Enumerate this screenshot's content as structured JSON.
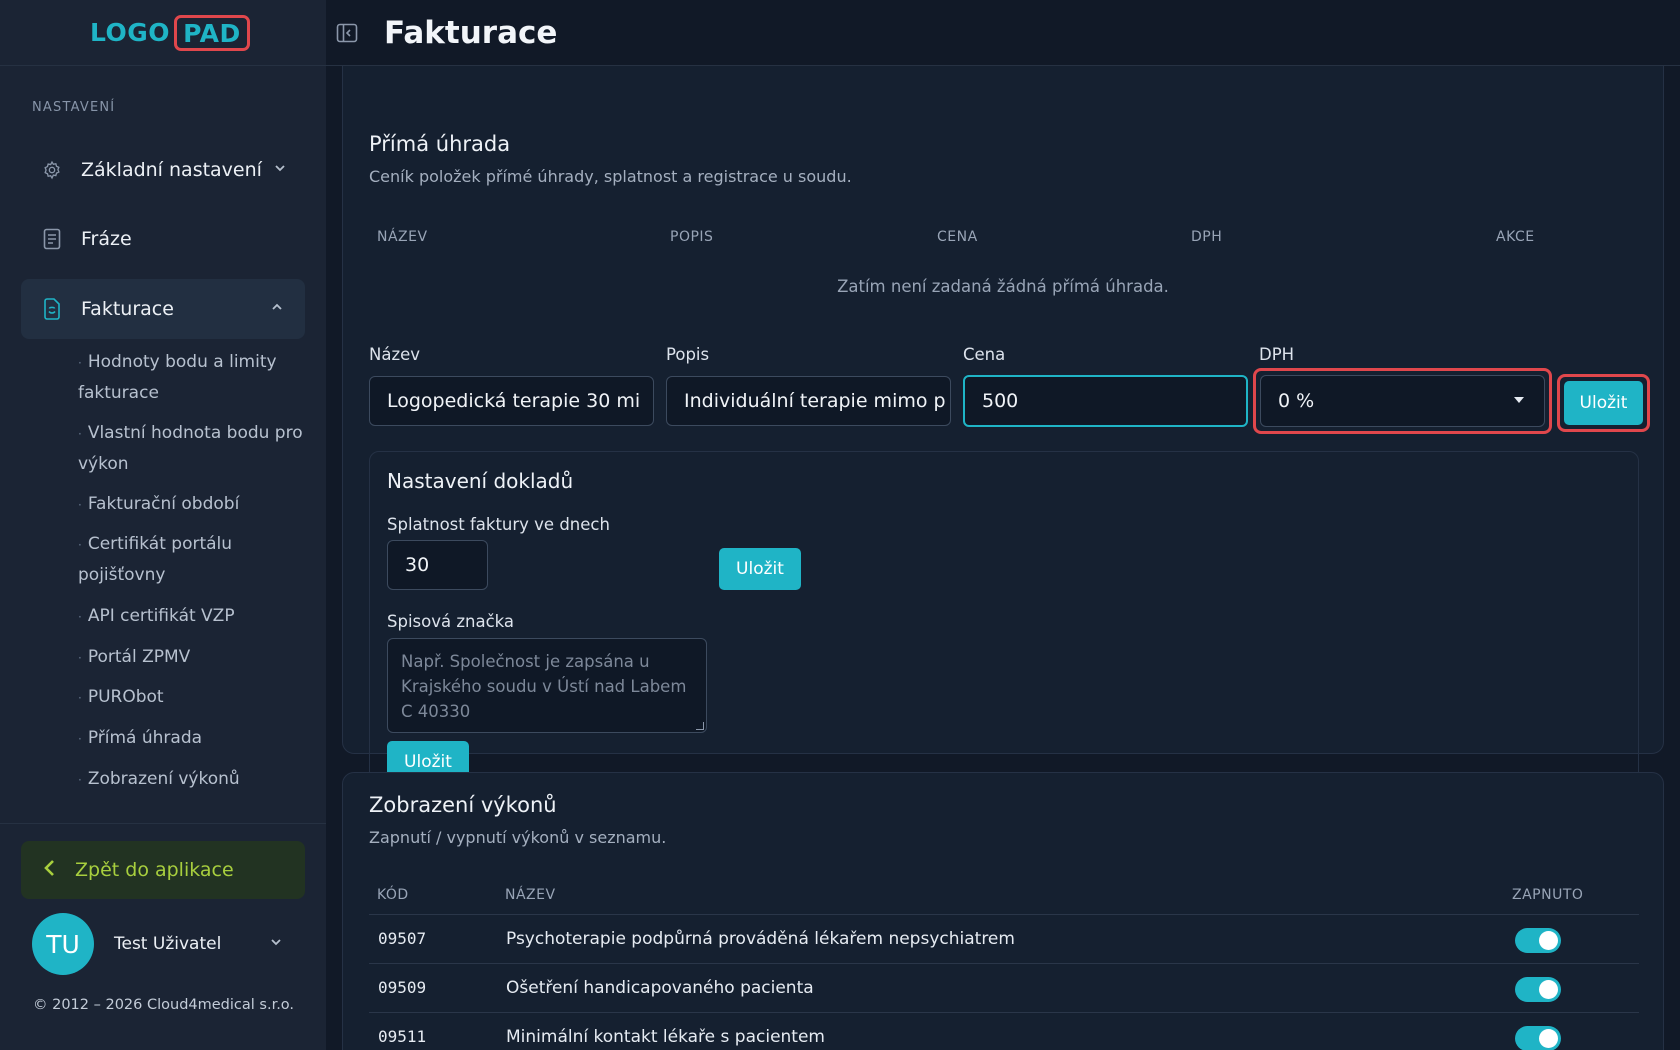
{
  "logo": {
    "part1": "LOGO",
    "part2": "PAD"
  },
  "sidebar": {
    "section_label": "NASTAVENÍ",
    "items": [
      {
        "label": "Základní nastavení",
        "icon": "gear-icon"
      },
      {
        "label": "Fráze",
        "icon": "document-icon"
      },
      {
        "label": "Fakturace",
        "icon": "invoice-icon"
      }
    ],
    "sub_items": [
      "Hodnoty bodu a limity fakturace",
      "Vlastní hodnota bodu pro výkon",
      "Fakturační období",
      "Certifikát portálu pojišťovny",
      "API certifikát VZP",
      "Portál ZPMV",
      "PURObot",
      "Přímá úhrada",
      "Zobrazení výkonů"
    ],
    "back_label": "Zpět do aplikace",
    "user": {
      "initials": "TU",
      "name": "Test Uživatel"
    },
    "copyright": "© 2012 – 2026 Cloud4medical s.r.o."
  },
  "header": {
    "title": "Fakturace"
  },
  "prima_uhrada": {
    "title": "Přímá úhrada",
    "subtitle": "Ceník položek přímé úhrady, splatnost a registrace u soudu.",
    "columns": [
      "NÁZEV",
      "POPIS",
      "CENA",
      "DPH",
      "AKCE"
    ],
    "empty_text": "Zatím není zadaná žádná přímá úhrada.",
    "form": {
      "name_label": "Název",
      "name_value": "Logopedická terapie 30 mi",
      "desc_label": "Popis",
      "desc_value": "Individuální terapie mimo p",
      "price_label": "Cena",
      "price_value": "500",
      "vat_label": "DPH",
      "vat_value": "0 %",
      "save_label": "Uložit"
    }
  },
  "doklady": {
    "title": "Nastavení dokladů",
    "due_label": "Splatnost faktury ve dnech",
    "due_value": "30",
    "due_save": "Uložit",
    "court_label": "Spisová značka",
    "court_placeholder": "Např. Společnost je zapsána u Krajského soudu v Ústí nad Labem C 40330",
    "court_save": "Uložit"
  },
  "vykony": {
    "title": "Zobrazení výkonů",
    "subtitle": "Zapnutí / vypnutí výkonů v seznamu.",
    "columns": [
      "KÓD",
      "NÁZEV",
      "ZAPNUTO"
    ],
    "rows": [
      {
        "code": "09507",
        "name": "Psychoterapie podpůrná prováděná lékařem nepsychiatrem",
        "enabled": true
      },
      {
        "code": "09509",
        "name": "Ošetření handicapovaného pacienta",
        "enabled": true
      },
      {
        "code": "09511",
        "name": "Minimální kontakt lékaře s pacientem",
        "enabled": true
      }
    ]
  },
  "colors": {
    "accent": "#1fb4c6",
    "highlight": "#e0474c",
    "back_green": "#a8cf3e",
    "background": "#111927"
  }
}
